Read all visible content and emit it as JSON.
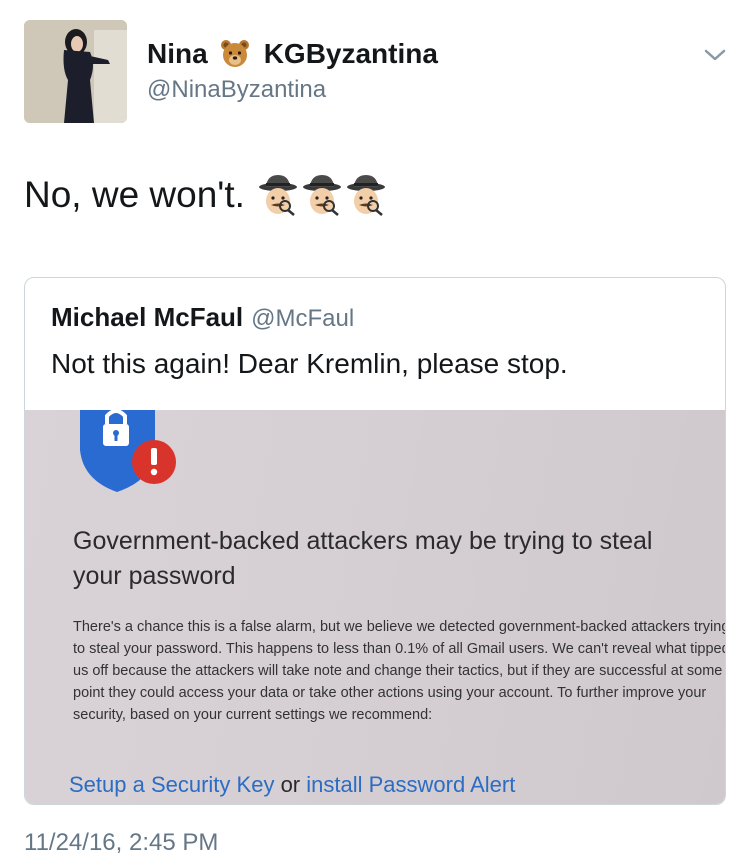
{
  "author": {
    "display_name_first": "Nina",
    "display_name_emoji": "bear-face-icon",
    "display_name_last": "KGByzantina",
    "handle": "@NinaByzantina"
  },
  "tweet": {
    "text": "No, we won't.",
    "emojis": [
      "sleuth-icon",
      "sleuth-icon",
      "sleuth-icon"
    ],
    "timestamp": "11/24/16, 2:45 PM"
  },
  "quoted": {
    "name": "Michael McFaul",
    "handle": "@McFaul",
    "text": "Not this again! Dear Kremlin, please stop.",
    "image": {
      "title": "Government-backed attackers may be trying to steal your password",
      "body": "There's a chance this is a false alarm, but we believe we detected government-backed attackers trying to steal your password. This happens to less than 0.1% of all Gmail users. We can't reveal what tipped us off because the attackers will take note and change their tactics, but if they are successful at some point they could access your data or take other actions using your account. To further improve your security, based on your current settings we recommend:",
      "link1": "Setup a Security Key",
      "link_sep": " or ",
      "link2": "install Password Alert"
    }
  },
  "colors": {
    "text": "#14171a",
    "secondary": "#657786",
    "border": "#ccd6dd",
    "link": "#2b6cc4",
    "shield_blue": "#2a6bd1",
    "alert_red": "#d9342b"
  }
}
